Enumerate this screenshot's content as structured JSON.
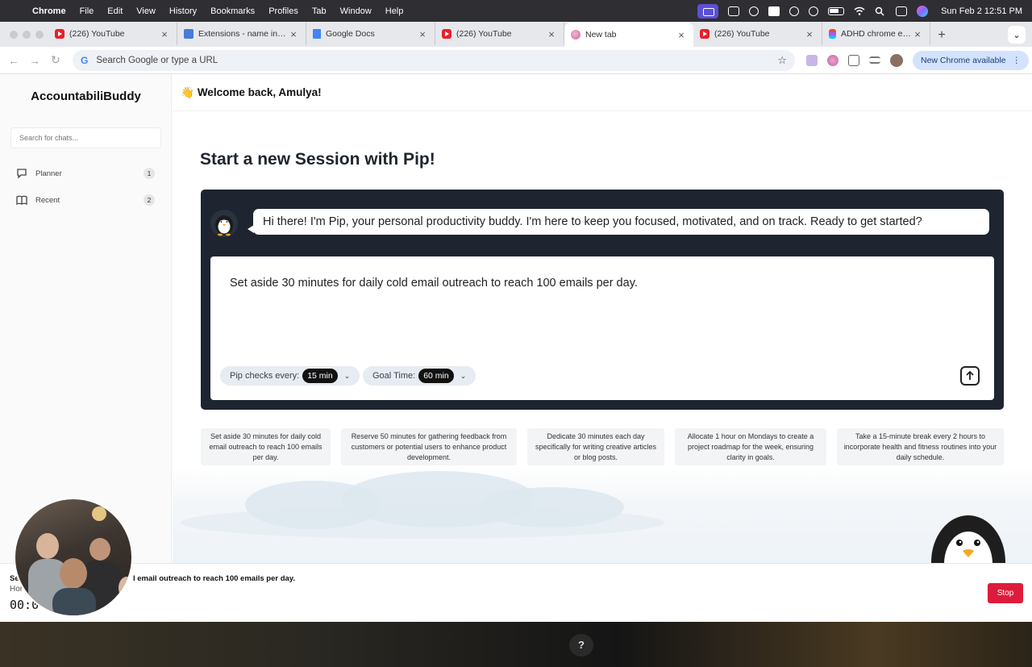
{
  "menubar": {
    "app": "Chrome",
    "items": [
      "File",
      "Edit",
      "View",
      "History",
      "Bookmarks",
      "Profiles",
      "Tab",
      "Window",
      "Help"
    ],
    "datetime": "Sun Feb 2  12:51 PM"
  },
  "tabs": [
    {
      "title": "(226) YouTube",
      "favicon": "youtube-icon"
    },
    {
      "title": "Extensions - name in man",
      "favicon": "puzzle-icon"
    },
    {
      "title": "Google Docs",
      "favicon": "docs-icon"
    },
    {
      "title": "(226) YouTube",
      "favicon": "youtube-icon"
    },
    {
      "title": "New tab",
      "favicon": "newtab-icon",
      "active": true
    },
    {
      "title": "(226) YouTube",
      "favicon": "youtube-icon"
    },
    {
      "title": "ADHD chrome ext app – F",
      "favicon": "figma-icon"
    }
  ],
  "toolbar": {
    "omnibox_placeholder": "Search Google or type a URL",
    "google_g": "G",
    "new_chrome": "New Chrome available"
  },
  "sidebar": {
    "brand": "AccountabiliBuddy",
    "search_placeholder": "Search for chats...",
    "items": [
      {
        "label": "Planner",
        "count": "1",
        "icon": "chat-icon"
      },
      {
        "label": "Recent",
        "count": "2",
        "icon": "book-icon"
      }
    ]
  },
  "main": {
    "wave": "👋",
    "welcome": "Welcome back, Amulya!",
    "hero": "Start a new Session with Pip!",
    "pip_message": "Hi there! I'm Pip, your personal productivity buddy. I'm here to keep you focused, motivated, and on track. Ready to get started?",
    "goal_text": "Set aside 30 minutes for daily cold email outreach to reach 100 emails per day.",
    "check_label": "Pip checks every:",
    "check_value": "15 min",
    "goal_label": "Goal Time:",
    "goal_value": "60 min",
    "suggestions": [
      "Set aside 30 minutes for daily cold email outreach to reach 100 emails per day.",
      "Reserve 50 minutes for gathering feedback from customers or potential users to enhance product development.",
      "Dedicate 30 minutes each day specifically for writing creative articles or blog posts.",
      "Allocate 1 hour on Mondays to create a project roadmap for the week, ensuring clarity in goals.",
      "Take a 15-minute break every 2 hours to incorporate health and fitness routines into your daily schedule."
    ]
  },
  "recording": {
    "prefix": "Se",
    "task": "l email outreach to reach 100 emails per day.",
    "sub": "Hor",
    "timer": "00:0",
    "stop": "Stop"
  },
  "desktop": {
    "help": "?"
  },
  "colors": {
    "accent_dark": "#1e2530",
    "stop_red": "#dd1c3b",
    "pill_bg": "#e7ecf2"
  }
}
